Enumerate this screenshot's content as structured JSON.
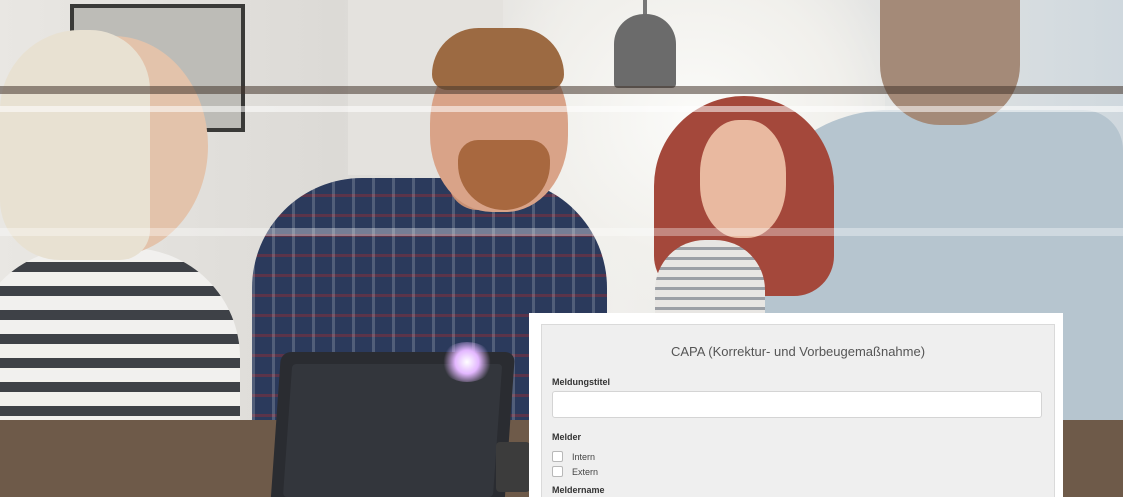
{
  "form": {
    "title": "CAPA (Korrektur- und Vorbeugemaßnahme)",
    "report_title_label": "Meldungstitel",
    "report_title_value": "",
    "reporter_label": "Melder",
    "reporter_options": [
      {
        "label": "Intern",
        "checked": false
      },
      {
        "label": "Extern",
        "checked": false
      }
    ],
    "reporter_name_label": "Meldername"
  },
  "colors": {
    "panel_bg": "#efefef",
    "title_text": "#555555",
    "label_text": "#333333"
  }
}
